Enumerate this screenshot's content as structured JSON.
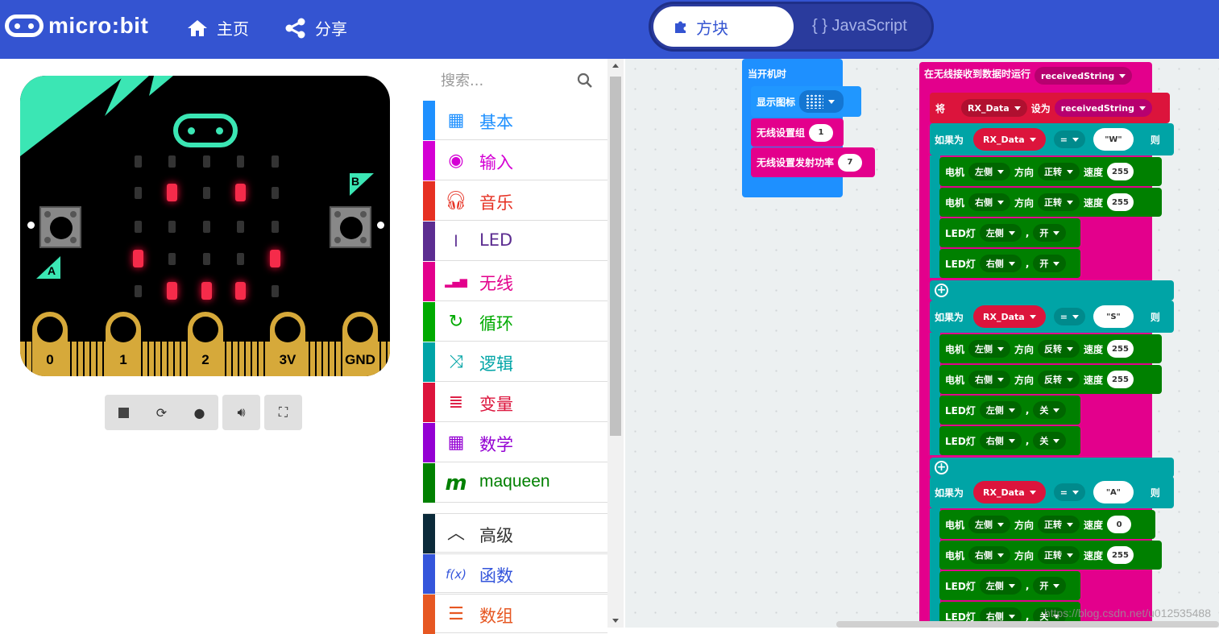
{
  "header": {
    "logo_text": "micro:bit",
    "home_label": "主页",
    "share_label": "分享",
    "blocks_tab": "方块",
    "js_tab": "{ } JavaScript"
  },
  "simulator": {
    "button_a": "A",
    "button_b": "B",
    "pins": [
      "0",
      "1",
      "2",
      "3V",
      "GND"
    ],
    "led_grid": [
      [
        0,
        0,
        0,
        0,
        0
      ],
      [
        0,
        1,
        0,
        1,
        0
      ],
      [
        0,
        0,
        0,
        0,
        0
      ],
      [
        1,
        0,
        0,
        0,
        1
      ],
      [
        0,
        1,
        1,
        1,
        0
      ]
    ],
    "controls": [
      "stop",
      "restart",
      "slowmo",
      "mute",
      "fullscreen"
    ]
  },
  "toolbox": {
    "search_placeholder": "搜索...",
    "categories": [
      {
        "label": "基本",
        "color": "#1e90ff",
        "icon": "grid-icon"
      },
      {
        "label": "输入",
        "color": "#d400d4",
        "icon": "target-icon"
      },
      {
        "label": "音乐",
        "color": "#e63022",
        "icon": "headphones-icon"
      },
      {
        "label": "LED",
        "color": "#5c2d91",
        "icon": "toggle-icon"
      },
      {
        "label": "无线",
        "color": "#e3008c",
        "icon": "signal-icon"
      },
      {
        "label": "循环",
        "color": "#00aa00",
        "icon": "refresh-icon"
      },
      {
        "label": "逻辑",
        "color": "#00a4a6",
        "icon": "shuffle-icon"
      },
      {
        "label": "变量",
        "color": "#dc143c",
        "icon": "lines-icon"
      },
      {
        "label": "数学",
        "color": "#9400d3",
        "icon": "calculator-icon"
      },
      {
        "label": "maqueen",
        "color": "#008000",
        "icon": "m-icon"
      },
      {
        "label": "高级",
        "color": "#333333",
        "icon": "chevron-up-icon"
      },
      {
        "label": "函数",
        "color": "#3455db",
        "icon": "fx-icon"
      },
      {
        "label": "数组",
        "color": "#e65722",
        "icon": "list-icon"
      }
    ]
  },
  "workspace": {
    "on_start": {
      "title": "当开机时",
      "show_icon": "显示图标",
      "radio_group": "无线设置组",
      "radio_group_value": "1",
      "radio_power": "无线设置发射功率",
      "radio_power_value": "7"
    },
    "on_received": {
      "title": "在无线接收到数据时运行",
      "param": "receivedString",
      "set": "将",
      "var": "RX_Data",
      "set_to": "设为",
      "if_label": "如果为",
      "then_label": "则",
      "eq": "=",
      "motor": "电机",
      "direction": "方向",
      "speed": "速度",
      "led": "LED灯",
      "comma": ",",
      "left": "左侧",
      "right": "右侧",
      "forward": "正转",
      "reverse": "反转",
      "on": "开",
      "off": "关",
      "cond1": "\"W\"",
      "cond2": "\"S\"",
      "cond3": "\"A\"",
      "s255": "255",
      "s0": "0"
    }
  },
  "watermark": "https://blog.csdn.net/u012535488"
}
